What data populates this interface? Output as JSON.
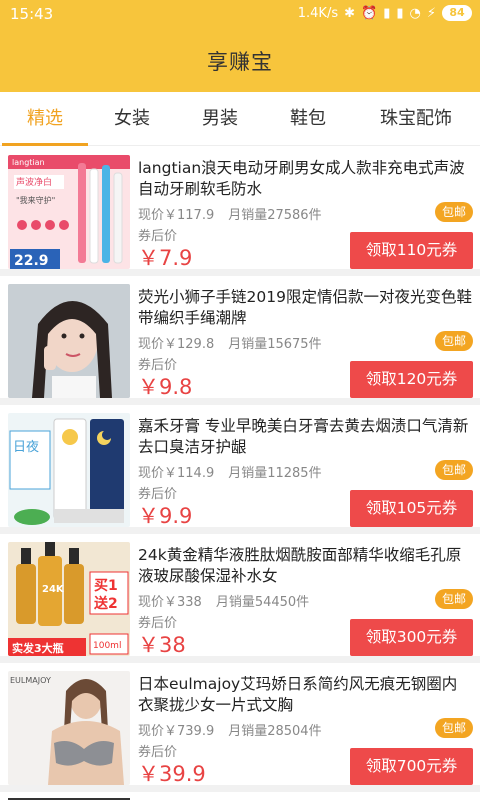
{
  "status": {
    "time": "15:43",
    "speed": "1.4K/s",
    "battery": "84",
    "icons": [
      "bluetooth-icon",
      "alarm-icon",
      "signal-4g-icon",
      "signal-icon",
      "wifi-icon",
      "charging-icon",
      "battery-icon"
    ]
  },
  "app": {
    "title": "享赚宝"
  },
  "tabs": [
    {
      "label": "精选",
      "active": true
    },
    {
      "label": "女装"
    },
    {
      "label": "男装"
    },
    {
      "label": "鞋包"
    },
    {
      "label": "珠宝配饰"
    }
  ],
  "items": [
    {
      "title": "langtian浪天电动牙刷男女成人款非充电式声波自动牙刷软毛防水",
      "current": "现价￥117.9",
      "sales": "月销量27586件",
      "after_label": "券后价",
      "price": "￥7.9",
      "badge": "包邮",
      "coupon": "领取110元券",
      "thumb": {
        "brand": "langtian",
        "tag": "声波净白",
        "sub": "\"我来守护\"",
        "price": "22.9"
      }
    },
    {
      "title": "荧光小狮子手链2019限定情侣款一对夜光变色鞋带编织手绳潮牌",
      "current": "现价￥129.8",
      "sales": "月销量15675件",
      "after_label": "券后价",
      "price": "￥9.8",
      "badge": "包邮",
      "coupon": "领取120元券"
    },
    {
      "title": "嘉禾牙膏 专业早晚美白牙膏去黄去烟渍口气清新去口臭洁牙护龈",
      "current": "现价￥114.9",
      "sales": "月销量11285件",
      "after_label": "券后价",
      "price": "￥9.9",
      "badge": "包邮",
      "coupon": "领取105元券",
      "thumb": {
        "tag": "日夜"
      }
    },
    {
      "title": "24k黄金精华液胜肽烟酰胺面部精华收缩毛孔原液玻尿酸保湿补水女",
      "current": "现价￥338",
      "sales": "月销量54450件",
      "after_label": "券后价",
      "price": "￥38",
      "badge": "包邮",
      "coupon": "领取300元券",
      "thumb": {
        "bottle": "24K",
        "promo1": "买1",
        "promo2": "送2",
        "bottom": "实发3大瓶",
        "size": "100ml"
      }
    },
    {
      "title": "日本eulmajoy艾玛娇日系简约风无痕无钢圈内衣聚拢少女一片式文胸",
      "current": "现价￥739.9",
      "sales": "月销量28504件",
      "after_label": "券后价",
      "price": "￥39.9",
      "badge": "包邮",
      "coupon": "领取700元券",
      "thumb": {
        "brand": "EULMAJOY"
      }
    }
  ]
}
